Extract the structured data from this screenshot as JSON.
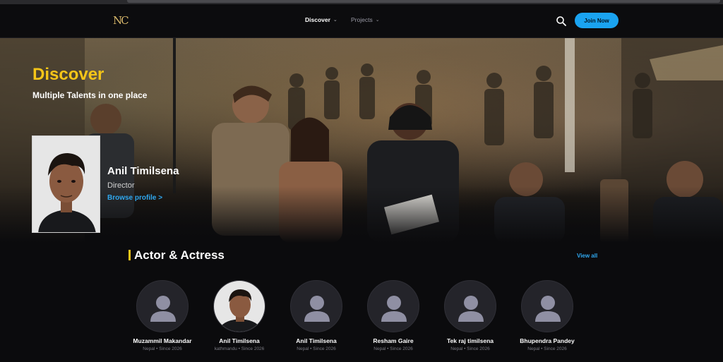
{
  "header": {
    "logo": "NC",
    "nav": [
      {
        "label": "Discover"
      },
      {
        "label": "Projects"
      }
    ],
    "join_label": "Join Now"
  },
  "hero": {
    "title": "Discover",
    "subtitle": "Multiple Talents in one place",
    "featured": {
      "name": "Anil Timilsena",
      "role": "Director",
      "link": "Browse profile >"
    }
  },
  "section": {
    "title": "Actor & Actress",
    "view_all": "View all"
  },
  "people": [
    {
      "name": "Muzammil Makandar",
      "location": "Nepal",
      "since": "Since 2026",
      "photo": false
    },
    {
      "name": "Anil Timilsena",
      "location": "kathmandu",
      "since": "Since 2026",
      "photo": true
    },
    {
      "name": "Anil Timilsena",
      "location": "Nepal",
      "since": "Since 2026",
      "photo": false
    },
    {
      "name": "Resham Gaire",
      "location": "Nepal",
      "since": "Since 2026",
      "photo": false
    },
    {
      "name": "Tek raj timilsena",
      "location": "Nepal",
      "since": "Since 2026",
      "photo": false
    },
    {
      "name": "Bhupendra Pandey",
      "location": "Nepal",
      "since": "Since 2026",
      "photo": false
    }
  ],
  "colors": {
    "accent": "#f5c518",
    "link": "#2fa8f0",
    "button": "#1aa3f0",
    "background": "#0b0b0d"
  },
  "icons": [
    "search-icon",
    "chevron-down-icon",
    "user-placeholder-icon"
  ]
}
